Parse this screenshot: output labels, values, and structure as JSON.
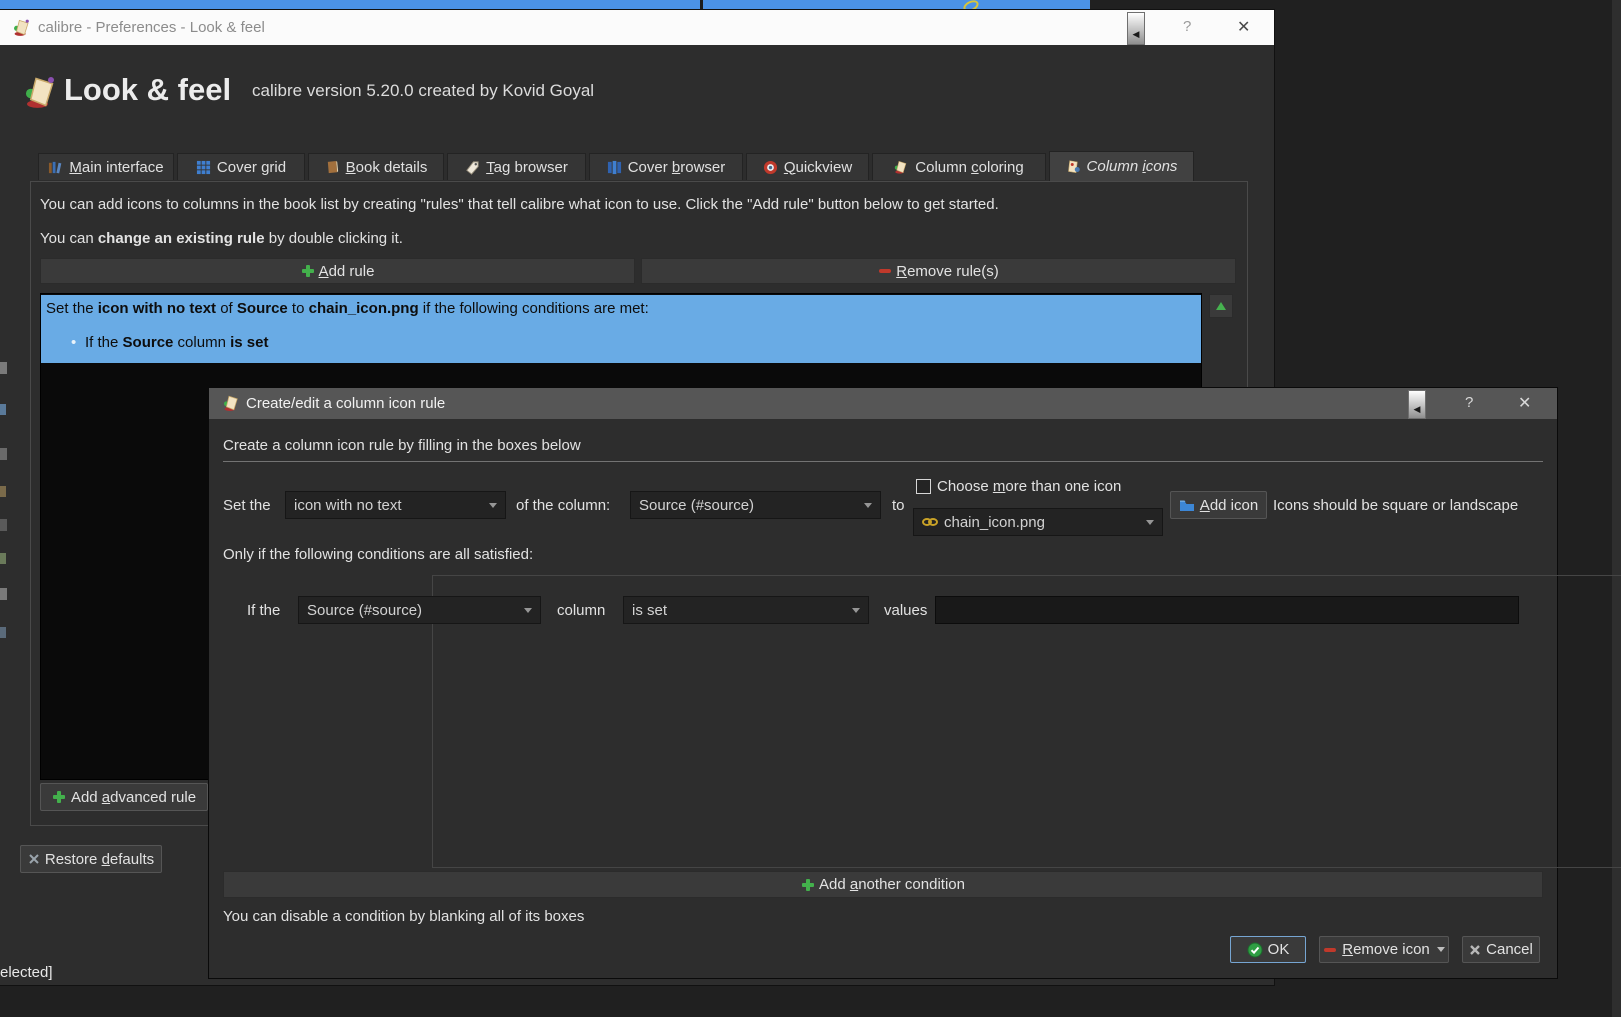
{
  "window": {
    "titlebar": {
      "title": "calibre - Preferences - Look & feel",
      "help_glyph": "?",
      "close_glyph": "✕",
      "caret_glyph": "◀"
    },
    "header": {
      "title": "Look & feel",
      "subtitle": "calibre version 5.20.0 created by Kovid Goyal"
    },
    "tabs": [
      {
        "pre": "",
        "u": "M",
        "post": "ain interface"
      },
      {
        "pre": "Cover ",
        "u": "g",
        "post": "rid"
      },
      {
        "pre": "",
        "u": "B",
        "post": "ook details"
      },
      {
        "pre": "",
        "u": "T",
        "post": "ag browser"
      },
      {
        "pre": "Cover ",
        "u": "b",
        "post": "rowser"
      },
      {
        "pre": "",
        "u": "Q",
        "post": "uickview"
      },
      {
        "pre": "Column ",
        "u": "c",
        "post": "oloring"
      },
      {
        "pre": "Column ",
        "u": "i",
        "post": "cons"
      }
    ],
    "intro_line1": "You can add icons to columns in the book list by creating \"rules\" that tell calibre what icon to use. Click the \"Add rule\" button below to get started.",
    "intro_line2": {
      "pre": "You can ",
      "bold": "change an existing rule",
      "post": " by double clicking it."
    },
    "add_rule_button": {
      "pre": "",
      "u": "A",
      "post": "dd rule"
    },
    "remove_rule_button": {
      "pre": "",
      "u": "R",
      "post": "emove rule(s)"
    },
    "rule": {
      "seg1": "Set the ",
      "seg2": "icon with no text",
      "seg3": " of ",
      "seg4": "Source",
      "seg5": " to ",
      "seg6": "chain_icon.png",
      "seg7": " if the following conditions are met:",
      "bullet": "•",
      "cond1": "If the ",
      "cond2": "Source",
      "cond3": " column ",
      "cond4": "is set"
    },
    "add_advanced_button": {
      "pre": "Add ",
      "u": "a",
      "post": "dvanced rule"
    },
    "restore_defaults_button": {
      "pre": "Restore ",
      "u": "d",
      "post": "efaults"
    },
    "bottom_partial_text": "elected]"
  },
  "dialog": {
    "titlebar": {
      "title": "Create/edit a column icon rule",
      "help_glyph": "?",
      "close_glyph": "✕",
      "caret_glyph": "◀"
    },
    "subtitle": "Create a column icon rule by filling in the boxes below",
    "row1": {
      "set_the": "Set the",
      "kind_value": "icon with no text",
      "of_the_column": "of the column:",
      "column_value": "Source (#source)",
      "to": "to",
      "choose_more": {
        "pre": "Choose ",
        "u": "m",
        "post": "ore than one icon"
      },
      "icon_value": "chain_icon.png",
      "add_icon_button": {
        "pre": "",
        "u": "A",
        "post": "dd icon"
      },
      "note": "Icons should be square or landscape"
    },
    "only_if": "Only if the following conditions are all satisfied:",
    "condition": {
      "if_the": "If the",
      "column_value": "Source (#source)",
      "column_label": "column",
      "op_value": "is set",
      "values_label": "values",
      "values_text": ""
    },
    "add_condition_button": {
      "pre": "Add ",
      "u": "a",
      "post": "nother condition"
    },
    "disable_note": "You can disable a condition by blanking all of its boxes",
    "buttons": {
      "ok": "OK",
      "remove_icon": {
        "pre": "",
        "u": "R",
        "post": "emove icon"
      },
      "cancel": "Cancel"
    }
  }
}
